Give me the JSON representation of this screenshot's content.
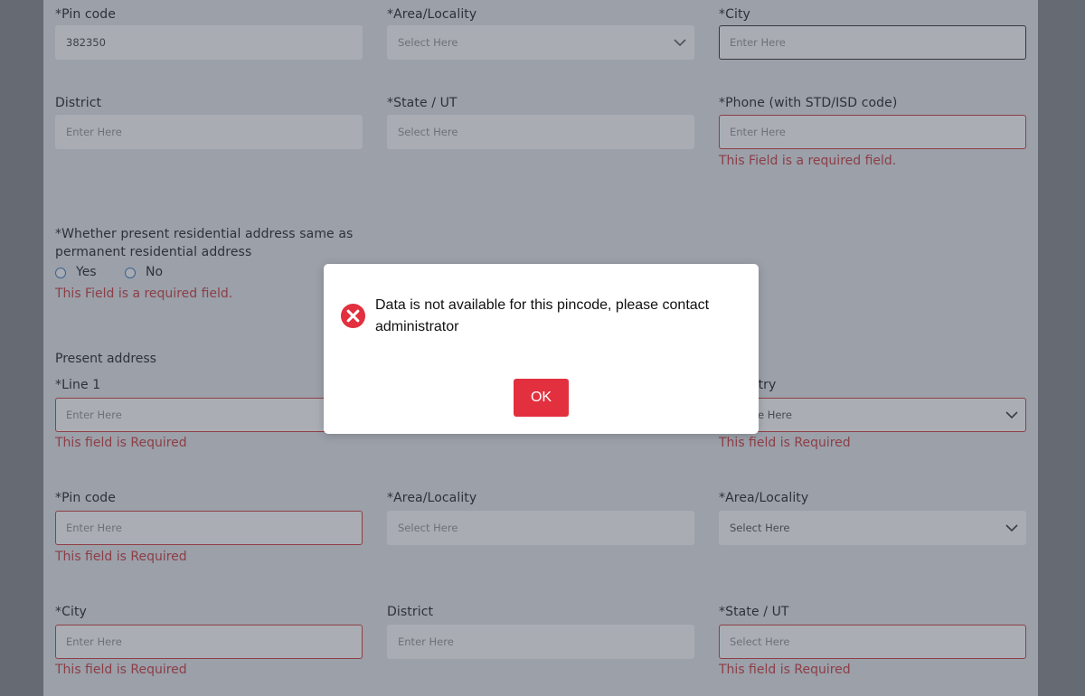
{
  "address_top": {
    "pincode": {
      "label": "*Pin code",
      "value": "382350"
    },
    "area": {
      "label": "*Area/Locality",
      "placeholder": "Select Here"
    },
    "city": {
      "label": "*City",
      "placeholder": "Enter Here"
    },
    "district": {
      "label": "District",
      "placeholder": "Enter Here"
    },
    "state": {
      "label": "*State / UT",
      "placeholder": "Select Here"
    },
    "phone": {
      "label": "*Phone (with STD/ISD code)",
      "placeholder": "Enter Here",
      "error": "This Field is a required field."
    }
  },
  "same_address": {
    "question_line1": "*Whether present residential address same as",
    "question_line2": "permanent residential address",
    "yes": "Yes",
    "no": "No",
    "error": "This Field is a required field."
  },
  "present_address": {
    "title": "Present address",
    "line1": {
      "label": "*Line 1",
      "placeholder": "Enter Here",
      "error": "This field is Required"
    },
    "country": {
      "label_fragment": "try",
      "placeholder_fragment": "e Here",
      "error": "This field is Required"
    },
    "pincode": {
      "label": "*Pin code",
      "placeholder": "Enter Here",
      "error": "This field is Required"
    },
    "area": {
      "label": "*Area/Locality",
      "placeholder": "Select Here"
    },
    "area2": {
      "label": "*Area/Locality",
      "placeholder": "Select Here"
    },
    "city": {
      "label": "*City",
      "placeholder": "Enter Here",
      "error": "This field is Required"
    },
    "district": {
      "label": "District",
      "placeholder": "Enter Here"
    },
    "state": {
      "label": "*State / UT",
      "placeholder": "Select Here",
      "error": "This field is Required"
    }
  },
  "dialog": {
    "message": "Data is not available for this pincode, please contact administrator",
    "ok_label": "OK",
    "icon": "error-circle-x-icon",
    "accent_color": "#e2303f"
  }
}
